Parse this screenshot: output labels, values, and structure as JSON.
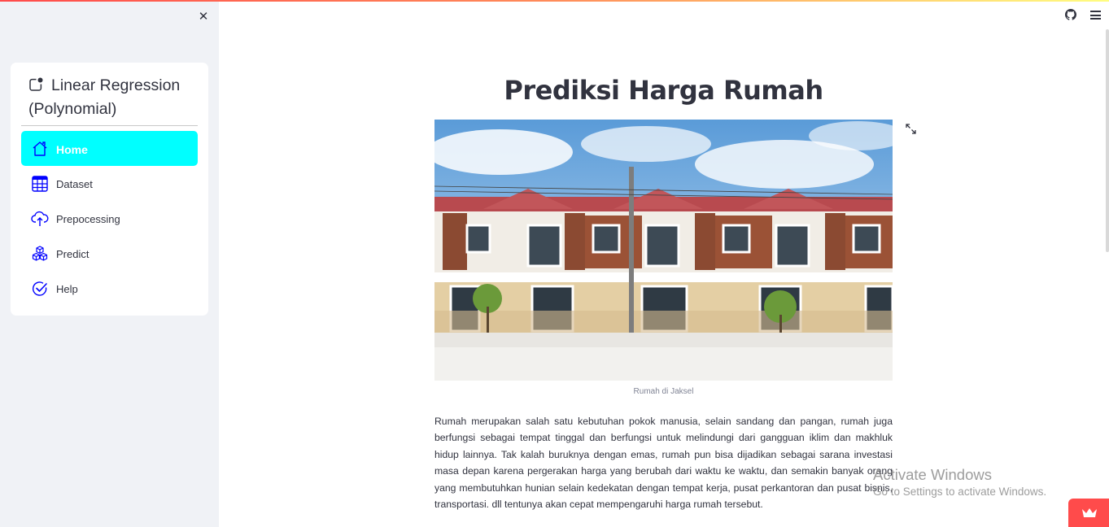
{
  "sidebar": {
    "close_icon": "close-icon",
    "menu": {
      "title": "Linear Regression (Polynomial)",
      "title_icon": "app-indicator-icon",
      "items": [
        {
          "label": "Home",
          "icon": "house-icon",
          "active": true
        },
        {
          "label": "Dataset",
          "icon": "table-icon",
          "active": false
        },
        {
          "label": "Prepocessing",
          "icon": "cloud-upload-icon",
          "active": false
        },
        {
          "label": "Predict",
          "icon": "boxes-icon",
          "active": false
        },
        {
          "label": "Help",
          "icon": "check-circle-icon",
          "active": false
        }
      ],
      "active_color": "#00ffff"
    }
  },
  "header": {
    "github_icon": "github-icon",
    "menu_icon": "hamburger-menu-icon"
  },
  "main": {
    "title": "Prediksi Harga Rumah",
    "image_caption": "Rumah di Jaksel",
    "paragraph": "Rumah merupakan salah satu kebutuhan pokok manusia, selain sandang dan pangan, rumah juga berfungsi sebagai tempat tinggal dan berfungsi untuk melindungi dari gangguan iklim dan makhluk hidup lainnya. Tak kalah buruknya dengan emas, rumah pun bisa dijadikan sebagai sarana investasi masa depan karena pergerakan harga yang berubah dari waktu ke waktu, dan semakin banyak orang yang membutuhkan hunian selain kedekatan dengan tempat kerja, pusat perkantoran dan pusat bisnis, transportasi. dll tentunya akan cepat mempengaruhi harga rumah tersebut."
  },
  "watermark": {
    "title": "Activate Windows",
    "subtitle": "Go to Settings to activate Windows."
  },
  "colors": {
    "accent": "#ff4b4b",
    "sidebar_bg": "#f0f2f6",
    "text": "#31333f"
  }
}
